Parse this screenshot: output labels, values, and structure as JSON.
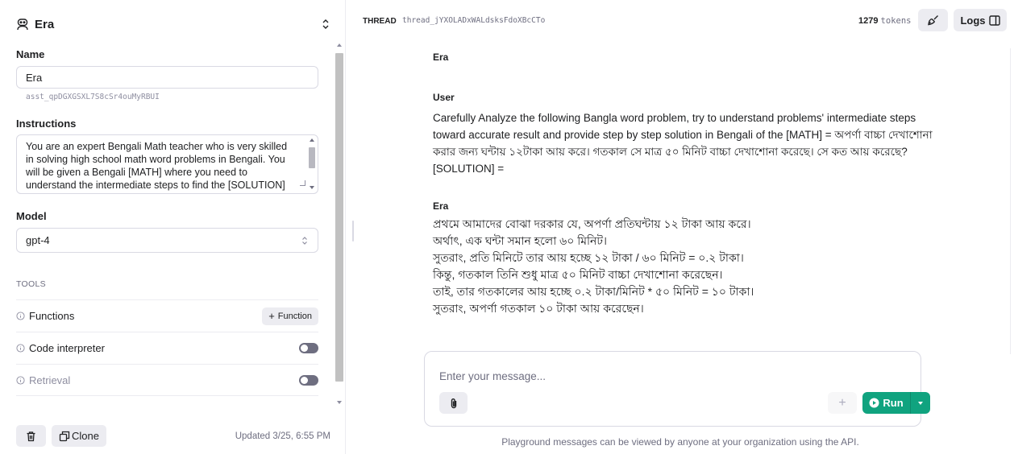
{
  "assistant": {
    "name": "Era",
    "name_label": "Name",
    "name_value": "Era",
    "id": "asst_qpDGXGSXL7S8cSr4ouMyRBUI",
    "instructions_label": "Instructions",
    "instructions_value": "You are an expert Bengali Math teacher who is very skilled in solving high school math word problems in Bengali. You will be given a Bengali [MATH] where you need to understand the intermediate steps to find the [SOLUTION] in Bengali with necessary caution to make sure you answer correctly and",
    "model_label": "Model",
    "model_value": "gpt-4",
    "tools_label": "TOOLS",
    "tools": [
      {
        "name": "Functions",
        "action": "Function"
      },
      {
        "name": "Code interpreter"
      },
      {
        "name": "Retrieval"
      }
    ],
    "clone_label": "Clone",
    "updated": "Updated 3/25, 6:55 PM"
  },
  "thread": {
    "label": "THREAD",
    "id": "thread_jYXOLADxWALdsksFdoXBcCTo",
    "tokens_count": "1279",
    "tokens_label": "tokens",
    "logs_label": "Logs",
    "messages": [
      {
        "role": "Era",
        "text": ""
      },
      {
        "role": "User",
        "text": "Carefully Analyze the following Bangla word problem, try to understand problems' intermediate steps toward accurate result and provide step by step solution in Bengali of the [MATH] = অপর্ণা বাচ্চা দেখাশোনা করার জন্য ঘন্টায় ১২টাকা আয় করে। গতকাল সে মাত্র ৫০ মিনিট বাচ্চা দেখাশোনা করেছে। সে কত আয় করেছে? [SOLUTION] ="
      },
      {
        "role": "Era",
        "lines": [
          "প্রথমে আমাদের বোঝা দরকার যে, অপর্ণা প্রতিঘন্টায় ১২ টাকা আয় করে।",
          "অর্থাৎ, এক ঘন্টা সমান হলো ৬০ মিনিট।",
          "সুতরাং, প্রতি মিনিটে তার আয় হচ্ছে ১২ টাকা / ৬০ মিনিট = ০.২ টাকা।",
          "কিন্তু, গতকাল তিনি শুধু মাত্র ৫০ মিনিট বাচ্চা দেখাশোনা করেছেন।",
          "তাই, তার গতকালের আয় হচ্ছে ০.২ টাকা/মিনিট * ৫০ মিনিট = ১০ টাকা।",
          "সুতরাং, অপর্ণা গতকাল ১০ টাকা আয় করেছেন।"
        ]
      }
    ]
  },
  "composer": {
    "placeholder": "Enter your message...",
    "run_label": "Run",
    "note": "Playground messages can be viewed by anyone at your organization using the API."
  },
  "icons": {
    "assistant": "robot-icon",
    "selector": "chevron-updown-icon",
    "info": "info-circle-icon",
    "trash": "trash-icon",
    "clone": "copy-icon",
    "clear": "broom-icon",
    "logs": "sidebar-panel-icon",
    "attach": "paperclip-icon",
    "run": "play-circle-icon"
  },
  "colors": {
    "accent": "#10a37f",
    "border": "#d9d9e3",
    "muted": "#6e6e80"
  }
}
